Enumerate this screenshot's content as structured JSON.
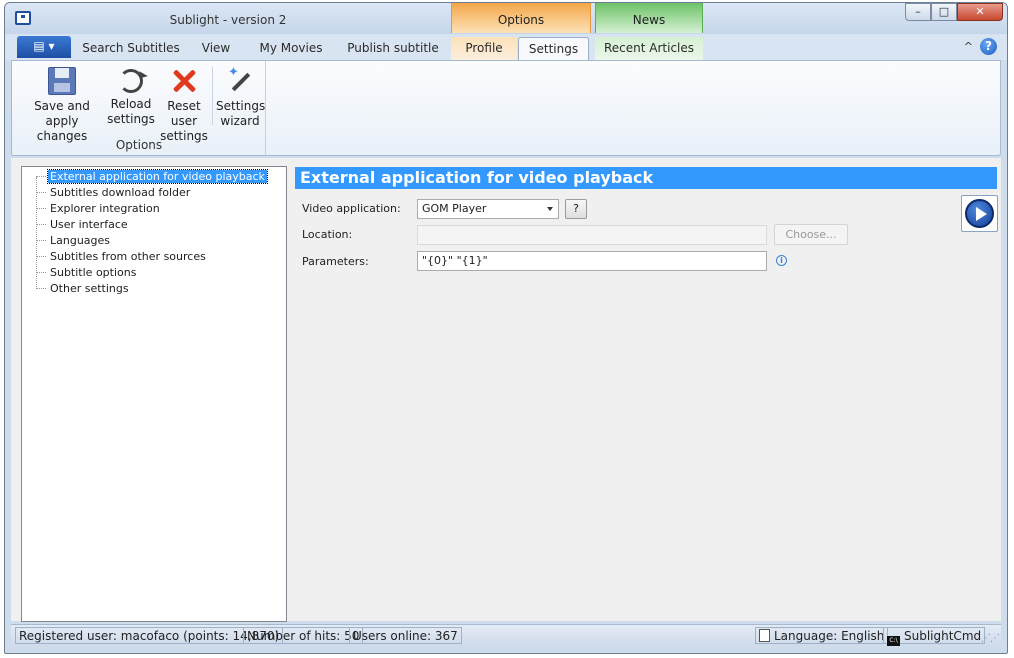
{
  "window": {
    "title": "Sublight - version 2",
    "controls": {
      "minimize": "–",
      "maximize": "□",
      "close": "✕"
    }
  },
  "context_tabs": {
    "options": "Options",
    "news": "News"
  },
  "tabs": {
    "search_subtitles": "Search Subtitles",
    "view": "View",
    "my_movies": "My Movies",
    "publish_subtitle": "Publish subtitle",
    "profile": "Profile",
    "settings": "Settings",
    "recent_articles": "Recent Articles",
    "app_menu": "▤ ▾",
    "collapse": "^",
    "help": "?"
  },
  "ribbon": {
    "group_label": "Options",
    "save_line1": "Save and",
    "save_line2": "apply changes",
    "reload_line1": "Reload",
    "reload_line2": "settings",
    "reset_line1": "Reset user",
    "reset_line2": "settings",
    "wizard_line1": "Settings",
    "wizard_line2": "wizard"
  },
  "tree": {
    "items": [
      "External application for video playback",
      "Subtitles download folder",
      "Explorer integration",
      "User interface",
      "Languages",
      "Subtitles from other sources",
      "Subtitle options",
      "Other settings"
    ],
    "selected_index": 0
  },
  "panel": {
    "title": "External application for video playback",
    "video_app_label": "Video application:",
    "video_app_value": "GOM Player",
    "help_button": "?",
    "location_label": "Location:",
    "location_value": "",
    "choose_button": "Choose...",
    "parameters_label": "Parameters:",
    "parameters_value": "\"{0}\" \"{1}\"",
    "info_glyph": "i"
  },
  "status": {
    "registered_user": "Registered user: macofaco (points: 14,870)",
    "hits": "Number of hits: 50",
    "users_online": "Users online: 367",
    "language": "Language: English",
    "cmd": "SublightCmd",
    "cmd_icon_text": "C:\\"
  },
  "colors": {
    "selection": "#3399ff",
    "options_context": "#f3a648",
    "news_context": "#6cc267"
  }
}
